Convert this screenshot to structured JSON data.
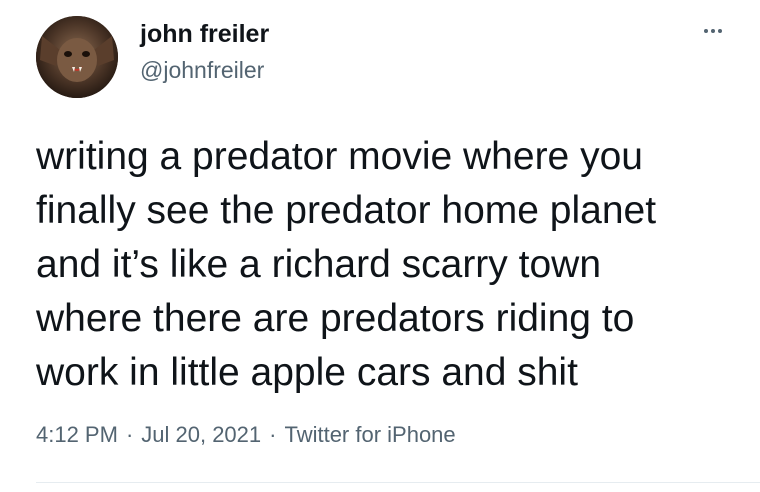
{
  "author": {
    "display_name": "john freiler",
    "handle": "@johnfreiler",
    "avatar_icon": "bat-face-avatar"
  },
  "more_icon": "more-dots-icon",
  "tweet": {
    "lines": [
      "writing a predator movie where you",
      "finally see the predator home planet",
      "and it’s like a richard scarry town",
      "where there are predators riding to",
      "work in little apple cars and shit"
    ]
  },
  "meta": {
    "time": "4:12 PM",
    "separator": "·",
    "date": "Jul 20, 2021",
    "client": "Twitter for iPhone"
  },
  "colors": {
    "text": "#0f1419",
    "secondary": "#536471",
    "divider": "#e6ecf0"
  }
}
